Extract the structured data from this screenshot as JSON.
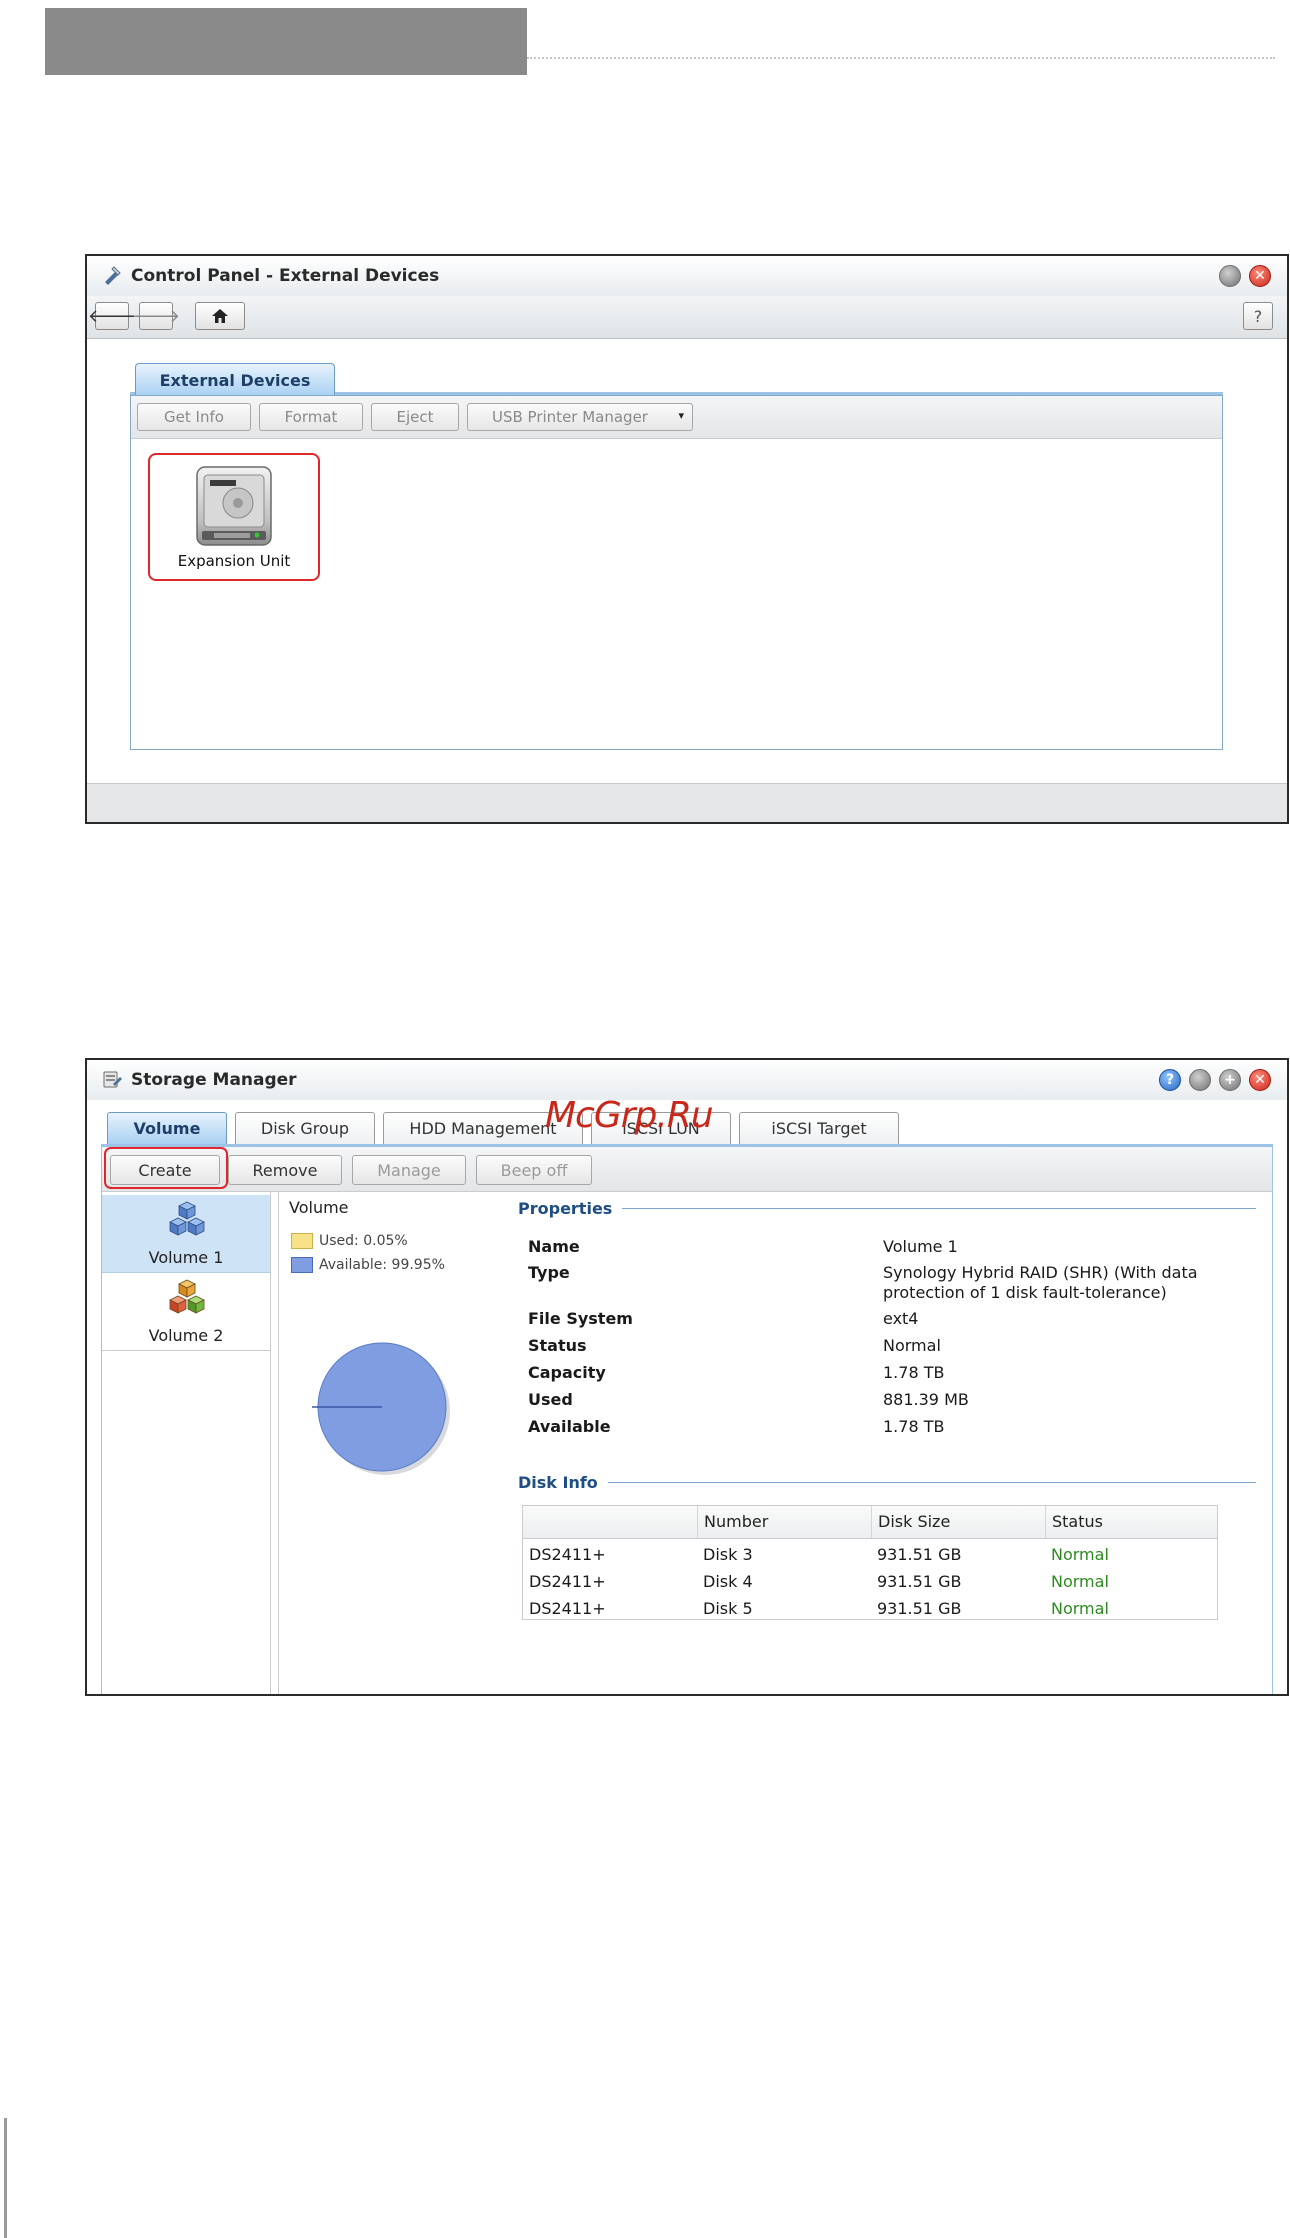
{
  "control_panel": {
    "title": "Control Panel - External Devices",
    "help_label": "?",
    "tab_label": "External Devices",
    "toolbar": {
      "get_info": "Get Info",
      "format": "Format",
      "eject": "Eject",
      "usb_printer_manager": "USB Printer Manager"
    },
    "device": {
      "label": "Expansion Unit",
      "icon": "hdd-icon"
    }
  },
  "storage_manager": {
    "title": "Storage Manager",
    "tabs": [
      "Volume",
      "Disk Group",
      "HDD Management",
      "iSCSI LUN",
      "iSCSI Target"
    ],
    "toolbar": {
      "create": "Create",
      "remove": "Remove",
      "manage": "Manage",
      "beep_off": "Beep off"
    },
    "volumes": [
      "Volume 1",
      "Volume 2"
    ],
    "chart": {
      "title": "Volume",
      "legend": [
        "Used: 0.05%",
        "Available: 99.95%"
      ],
      "colors": {
        "used": "#f7e28a",
        "available": "#7f9de0"
      }
    },
    "properties": {
      "heading": "Properties",
      "rows": [
        {
          "label": "Name",
          "value": "Volume 1"
        },
        {
          "label": "Type",
          "value": "Synology Hybrid RAID (SHR) (With data protection of 1 disk fault-tolerance)"
        },
        {
          "label": "File System",
          "value": "ext4"
        },
        {
          "label": "Status",
          "value": "Normal"
        },
        {
          "label": "Capacity",
          "value": "1.78 TB"
        },
        {
          "label": "Used",
          "value": "881.39 MB"
        },
        {
          "label": "Available",
          "value": "1.78 TB"
        }
      ]
    },
    "disk_info": {
      "heading": "Disk Info",
      "columns": [
        "",
        "Number",
        "Disk Size",
        "Status"
      ],
      "rows": [
        [
          "DS2411+",
          "Disk 3",
          "931.51 GB",
          "Normal"
        ],
        [
          "DS2411+",
          "Disk 4",
          "931.51 GB",
          "Normal"
        ],
        [
          "DS2411+",
          "Disk 5",
          "931.51 GB",
          "Normal"
        ]
      ]
    }
  },
  "watermark": "McGrp.Ru",
  "chart_data": {
    "type": "pie",
    "title": "Volume",
    "categories": [
      "Used",
      "Available"
    ],
    "values": [
      0.05,
      99.95
    ],
    "units": "%"
  }
}
